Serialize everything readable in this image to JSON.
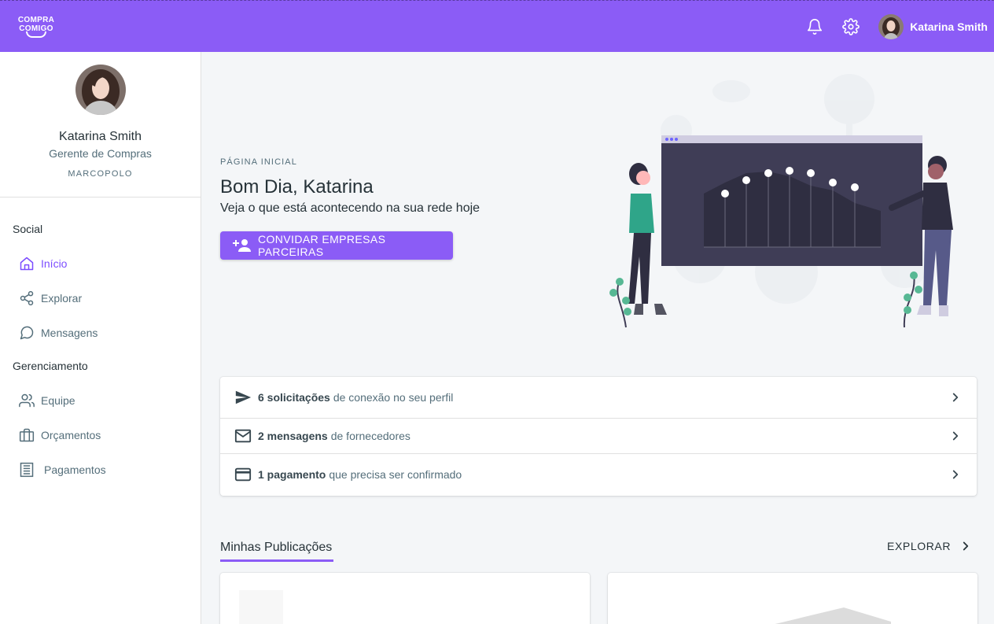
{
  "topbar": {
    "logo_line1": "COMPRA",
    "logo_line2": "COMIGO",
    "user_name": "Katarina Smith",
    "icons": [
      "bell-icon",
      "gear-icon"
    ],
    "accent_color": "#8b5cf6"
  },
  "profile": {
    "name": "Katarina Smith",
    "role": "Gerente de Compras",
    "company": "MARCOPOLO"
  },
  "nav": {
    "section_social": "Social",
    "section_management": "Gerenciamento",
    "items": [
      {
        "label": "Início",
        "icon": "home-icon",
        "active": true
      },
      {
        "label": "Explorar",
        "icon": "share-icon"
      },
      {
        "label": "Mensagens",
        "icon": "chat-bubble-icon"
      },
      {
        "label": "Equipe",
        "icon": "users-icon"
      },
      {
        "label": "Orçamentos",
        "icon": "briefcase-icon"
      },
      {
        "label": "Pagamentos",
        "icon": "receipt-icon"
      }
    ]
  },
  "header": {
    "overline": "PÁGINA INICIAL",
    "greeting": "Bom Dia, Katarina",
    "subtitle": "Veja o que está acontecendo na sua rede hoje",
    "invite_button": "CONVIDAR EMPRESAS PARCEIRAS"
  },
  "notifications": [
    {
      "bold": "6 solicitações",
      "text": "de conexão no seu perfil",
      "icon": "send-icon"
    },
    {
      "bold": "2 mensagens",
      "text": "de fornecedores",
      "icon": "mail-icon"
    },
    {
      "bold": "1 pagamento",
      "text": "que precisa ser confirmado",
      "icon": "credit-card-icon"
    }
  ],
  "publications": {
    "title": "Minhas Publicações",
    "explore_label": "EXPLORAR"
  }
}
